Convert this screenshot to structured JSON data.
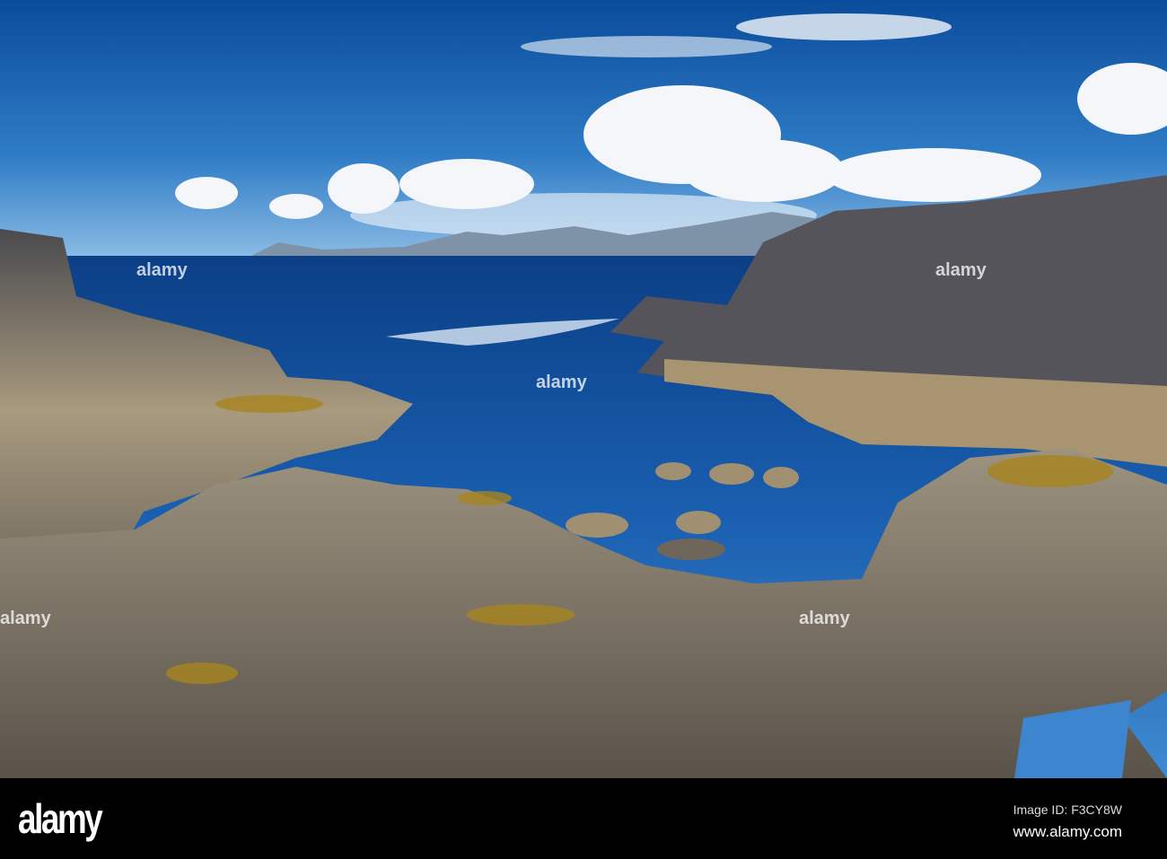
{
  "watermark": {
    "logo": "alamy",
    "image_id": "Image ID: F3CY8W",
    "site": "www.alamy.com"
  },
  "colors": {
    "sky_top": "#0b4f9e",
    "sky_horizon": "#5fa0d8",
    "sea": "#1f5fa8",
    "rock": "#8a8275",
    "footer": "#000000"
  }
}
